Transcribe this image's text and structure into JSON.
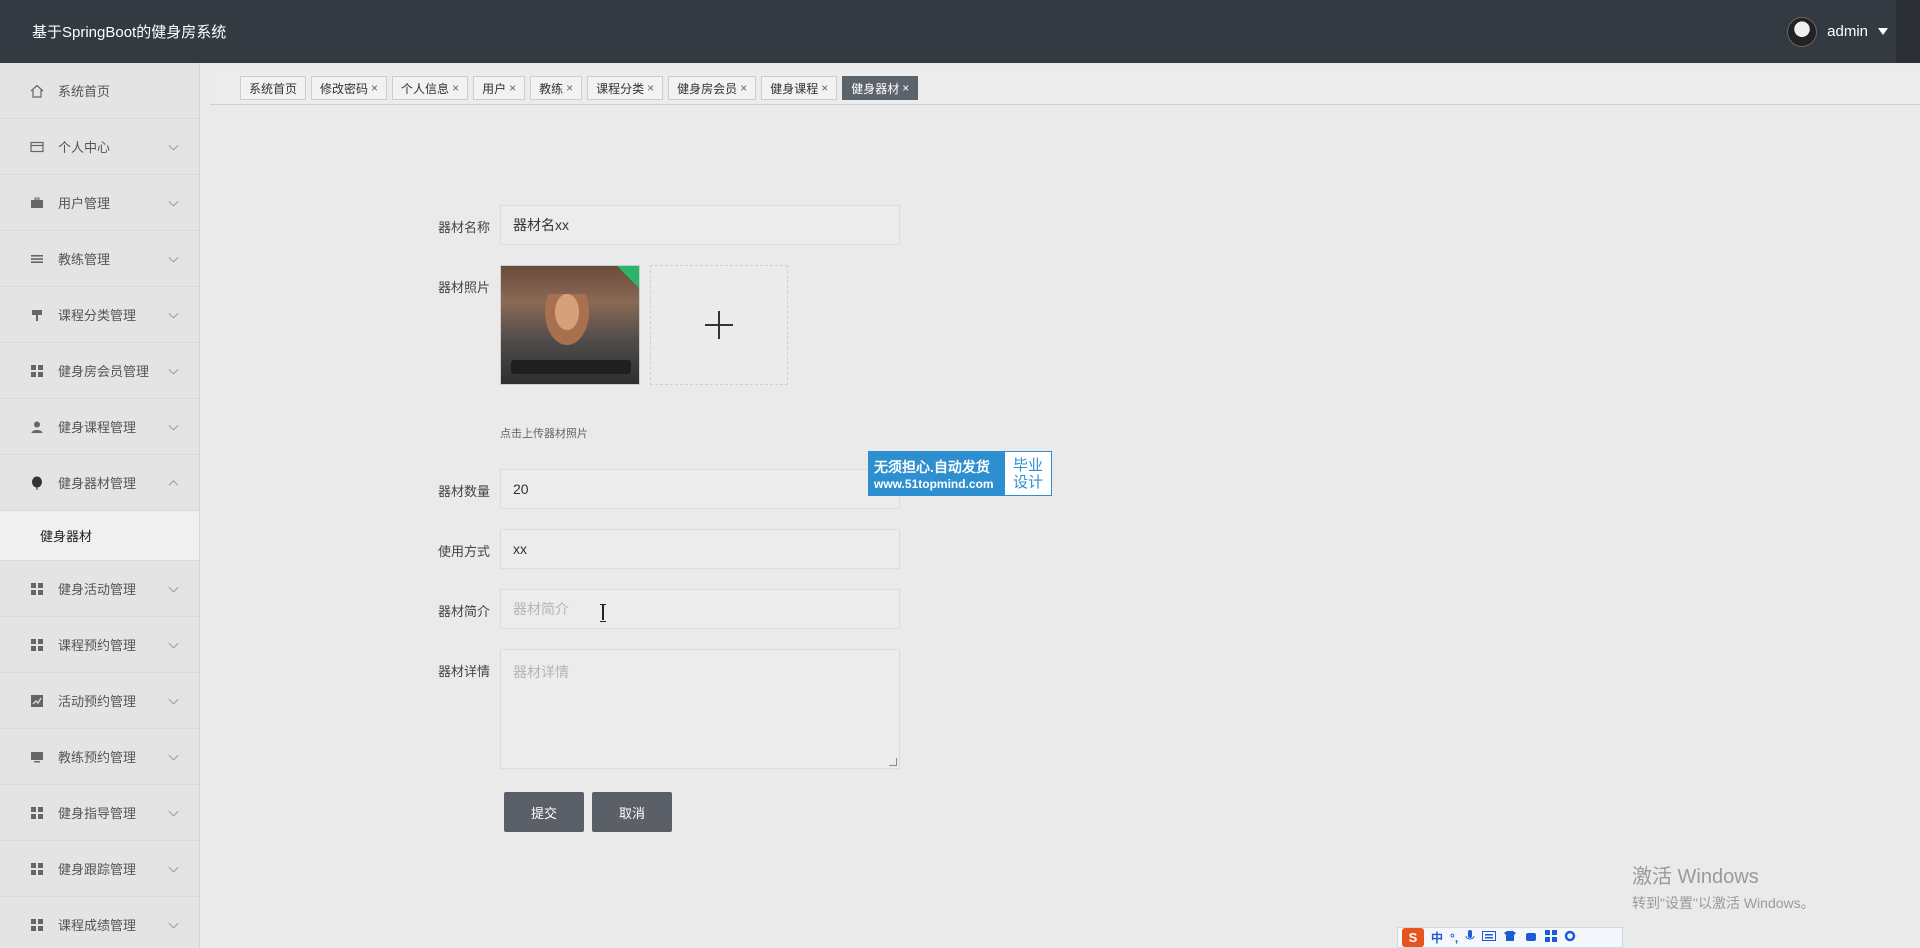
{
  "header": {
    "title": "基于SpringBoot的健身房系统",
    "username": "admin"
  },
  "sidebar": {
    "items": [
      {
        "label": "系统首页",
        "icon": "home-icon"
      },
      {
        "label": "个人中心",
        "icon": "card-icon"
      },
      {
        "label": "用户管理",
        "icon": "briefcase-icon"
      },
      {
        "label": "教练管理",
        "icon": "list-icon"
      },
      {
        "label": "课程分类管理",
        "icon": "brush-icon"
      },
      {
        "label": "健身房会员管理",
        "icon": "grid-icon"
      },
      {
        "label": "健身课程管理",
        "icon": "user-icon"
      },
      {
        "label": "健身器材管理",
        "icon": "balloon-icon"
      },
      {
        "label": "健身活动管理",
        "icon": "grid-icon"
      },
      {
        "label": "课程预约管理",
        "icon": "grid-icon"
      },
      {
        "label": "活动预约管理",
        "icon": "chart-icon"
      },
      {
        "label": "教练预约管理",
        "icon": "monitor-icon"
      },
      {
        "label": "健身指导管理",
        "icon": "grid-icon"
      },
      {
        "label": "健身跟踪管理",
        "icon": "grid-icon"
      },
      {
        "label": "课程成绩管理",
        "icon": "grid-icon"
      }
    ],
    "subitem": "健身器材"
  },
  "tabs": [
    "系统首页",
    "修改密码",
    "个人信息",
    "用户",
    "教练",
    "课程分类",
    "健身房会员",
    "健身课程",
    "健身器材"
  ],
  "form": {
    "name_label": "器材名称",
    "name_value": "器材名xx",
    "photo_label": "器材照片",
    "photo_hint": "点击上传器材照片",
    "qty_label": "器材数量",
    "qty_value": "20",
    "usage_label": "使用方式",
    "usage_value": "xx",
    "intro_label": "器材简介",
    "intro_placeholder": "器材简介",
    "detail_label": "器材详情",
    "detail_placeholder": "器材详情",
    "submit": "提交",
    "cancel": "取消"
  },
  "ad": {
    "line1": "无须担心.自动发货",
    "line2": "www.51topmind.com",
    "right1": "毕业",
    "right2": "设计"
  },
  "windows": {
    "line1": "激活 Windows",
    "line2": "转到\"设置\"以激活 Windows。"
  },
  "ime": {
    "logo": "S",
    "lang": "中",
    "punct": "°,"
  },
  "colors": {
    "header_bg": "#343a42",
    "active_tab": "#5d636c",
    "button": "#5b6068",
    "ad_blue": "#2d8fd0"
  }
}
